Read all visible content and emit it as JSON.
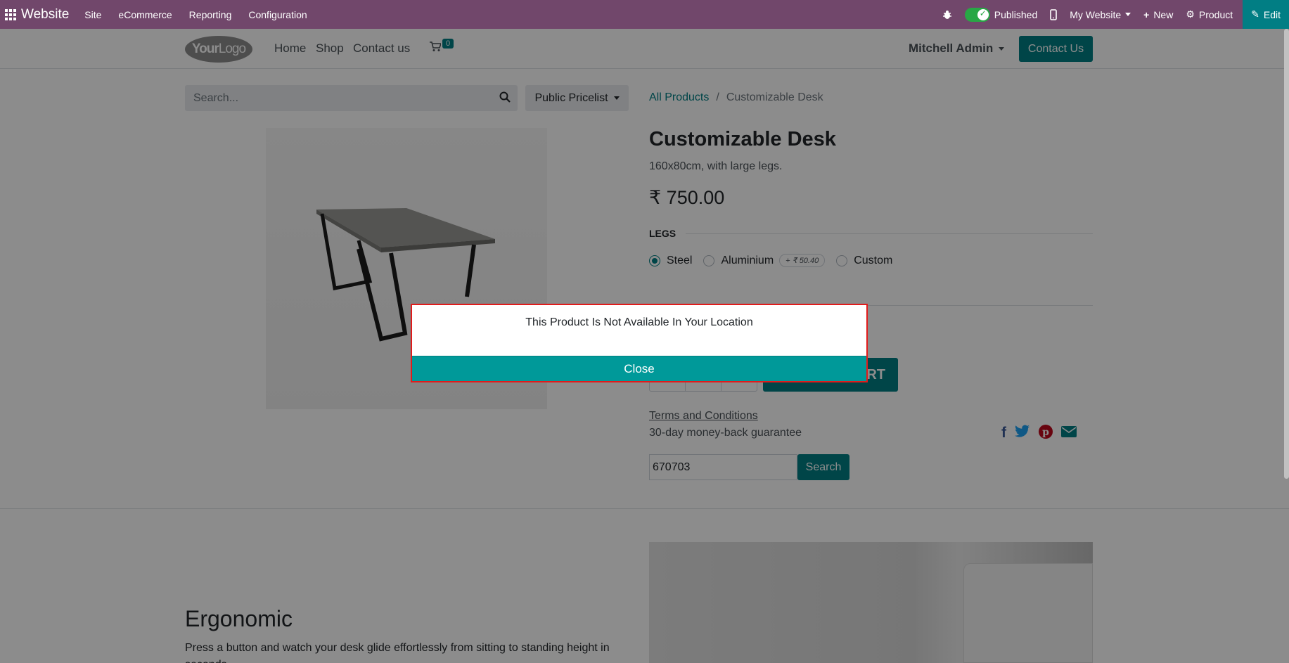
{
  "topbar": {
    "brand": "Website",
    "menus": [
      "Site",
      "eCommerce",
      "Reporting",
      "Configuration"
    ],
    "published_label": "Published",
    "website_label": "My Website",
    "new_label": "New",
    "product_label": "Product",
    "edit_label": "Edit"
  },
  "header": {
    "logo_bold": "Your",
    "logo_light": "Logo",
    "nav": [
      "Home",
      "Shop",
      "Contact us"
    ],
    "cart_count": "0",
    "user": "Mitchell Admin",
    "contact_button": "Contact Us"
  },
  "product": {
    "search_placeholder": "Search...",
    "pricelist": "Public Pricelist",
    "breadcrumb_link": "All Products",
    "breadcrumb_sep": "/",
    "breadcrumb_current": "Customizable Desk",
    "title": "Customizable Desk",
    "description": "160x80cm, with large legs.",
    "price": "₹ 750.00",
    "attribute_title": "LEGS",
    "options": [
      {
        "label": "Steel",
        "checked": true
      },
      {
        "label": "Aluminium",
        "extra": "+ ₹ 50.40"
      },
      {
        "label": "Custom"
      }
    ],
    "add_to_cart": "RT",
    "terms": "Terms and Conditions",
    "guarantee": "30-day money-back guarantee",
    "zip_value": "670703",
    "zip_button": "Search"
  },
  "ergonomic": {
    "title": "Ergonomic",
    "text": "Press a button and watch your desk glide effortlessly from sitting to standing height in seconds."
  },
  "modal": {
    "message": "This Product Is Not Available In Your Location",
    "close_label": "Close"
  },
  "colors": {
    "topbar": "#71476b",
    "primary": "#017e84",
    "modal_button": "#009999",
    "modal_border": "#e11b1b"
  }
}
